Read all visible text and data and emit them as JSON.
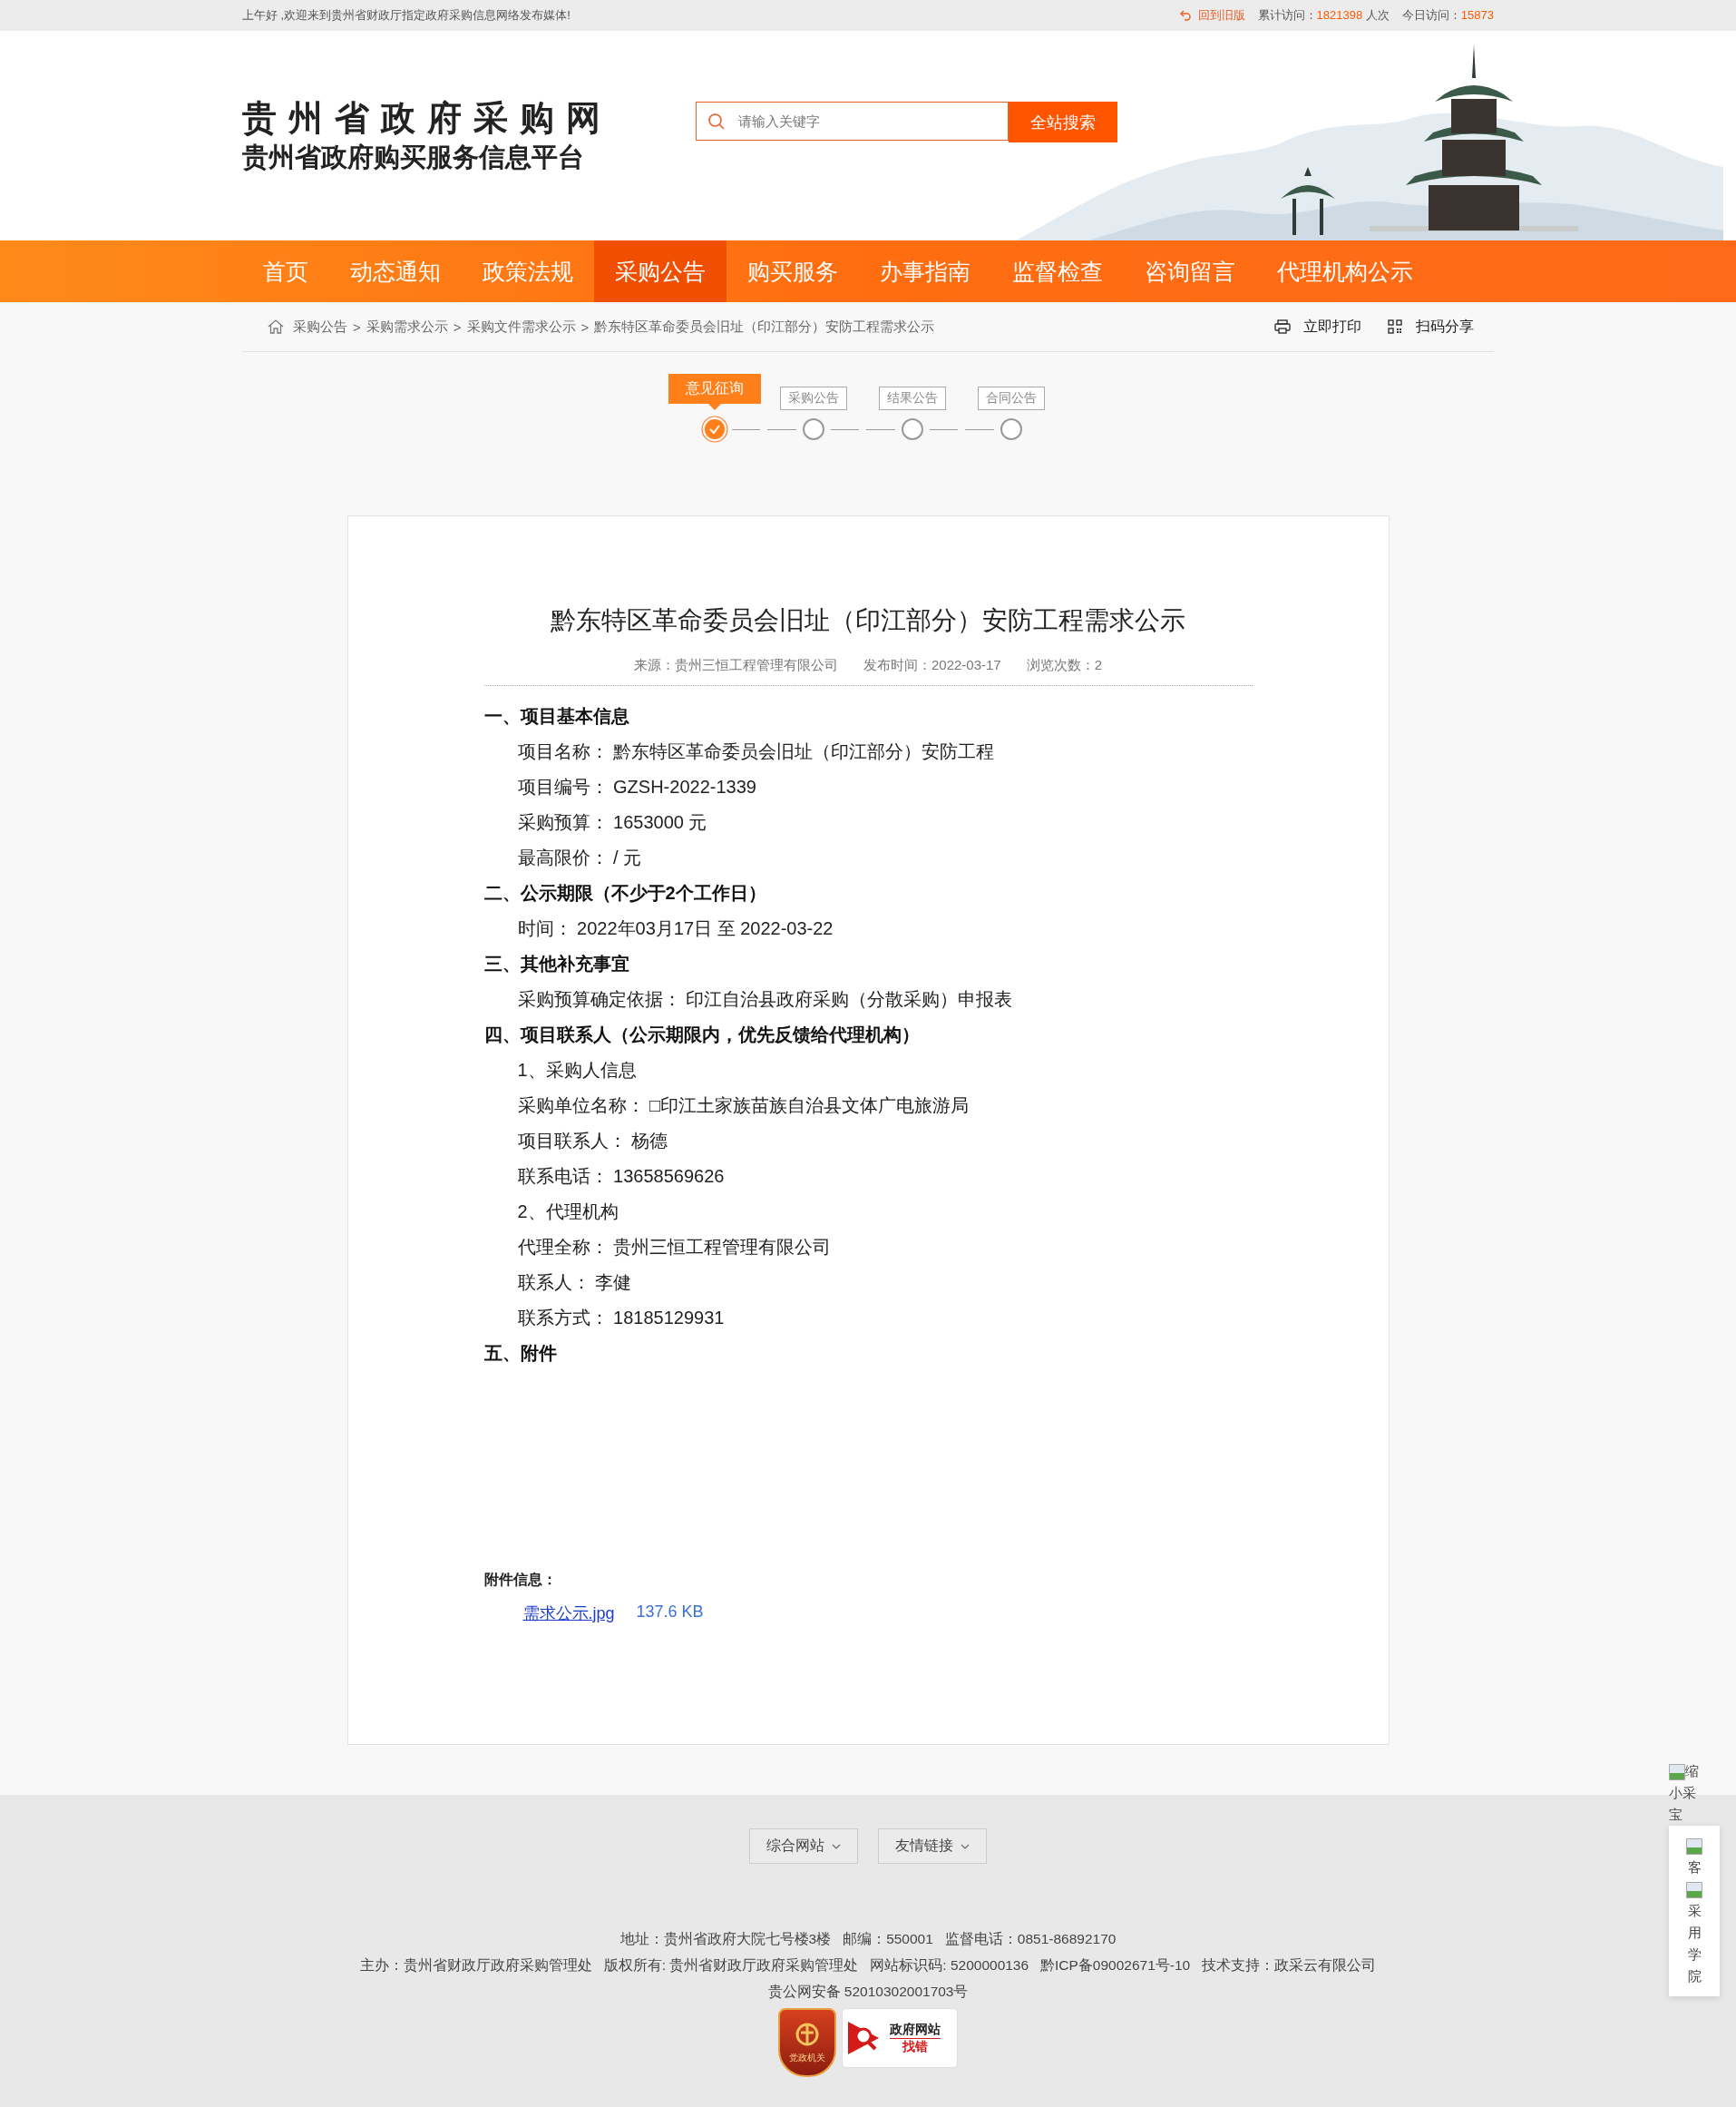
{
  "top_bar": {
    "greeting": "上午好 ,欢迎来到贵州省财政厅指定政府采购信息网络发布媒体!",
    "old_version_link": "回到旧版",
    "total_label": "累计访问：",
    "total_value": "1821398",
    "total_unit": "人次",
    "today_label": "今日访问：",
    "today_value": "15873"
  },
  "header": {
    "title": "贵州省政府采购网",
    "subtitle": "贵州省政府购买服务信息平台",
    "search": {
      "placeholder": "请输入关键字",
      "button": "全站搜索"
    }
  },
  "nav": [
    {
      "label": "首页",
      "selected": false
    },
    {
      "label": "动态通知",
      "selected": false
    },
    {
      "label": "政策法规",
      "selected": false
    },
    {
      "label": "采购公告",
      "selected": true
    },
    {
      "label": "购买服务",
      "selected": false
    },
    {
      "label": "办事指南",
      "selected": false
    },
    {
      "label": "监督检查",
      "selected": false
    },
    {
      "label": "咨询留言",
      "selected": false
    },
    {
      "label": "代理机构公示",
      "selected": false
    }
  ],
  "breadcrumb": {
    "separator": ">",
    "items": [
      "采购公告",
      "采购需求公示",
      "采购文件需求公示",
      "黔东特区革命委员会旧址（印江部分）安防工程需求公示"
    ]
  },
  "actions": [
    {
      "kind": "print",
      "label": "立即打印"
    },
    {
      "kind": "qr",
      "label": "扫码分享"
    }
  ],
  "steps": [
    {
      "label": "意见征询",
      "selected": true
    },
    {
      "label": "采购公告",
      "selected": false
    },
    {
      "label": "结果公告",
      "selected": false
    },
    {
      "label": "合同公告",
      "selected": false
    }
  ],
  "article": {
    "title": "黔东特区革命委员会旧址（印江部分）安防工程需求公示",
    "meta": [
      "来源：贵州三恒工程管理有限公司",
      "发布时间：2022-03-17",
      "浏览次数：2"
    ],
    "sections": [
      {
        "heading": "一、项目基本信息",
        "lines": [
          "项目名称： 黔东特区革命委员会旧址（印江部分）安防工程",
          "项目编号：  GZSH-2022-1339",
          "采购预算： 1653000 元",
          "最高限价： / 元"
        ]
      },
      {
        "heading": "二、公示期限（不少于2个工作日）",
        "lines": [
          "时间： 2022年03月17日 至  2022-03-22"
        ]
      },
      {
        "heading": "三、其他补充事宜",
        "lines": [
          "采购预算确定依据： 印江自治县政府采购（分散采购）申报表"
        ]
      },
      {
        "heading": "四、项目联系人（公示期限内，优先反馈给代理机构）",
        "lines": [
          "1、采购人信息",
          "采购单位名称： □印江土家族苗族自治县文体广电旅游局",
          "项目联系人： 杨德",
          "联系电话： 13658569626",
          "2、代理机构",
          "代理全称： 贵州三恒工程管理有限公司",
          "联系人： 李健",
          "联系方式： 18185129931"
        ]
      },
      {
        "heading": "五、附件"
      }
    ],
    "attachments": {
      "label": "附件信息：",
      "files": [
        {
          "name": "需求公示.jpg",
          "size": "137.6 KB"
        }
      ]
    }
  },
  "side_widgets": [
    "缩小采宝",
    "客",
    "采用学院"
  ],
  "footer": {
    "dropdowns": [
      "综合网站",
      "友情链接"
    ],
    "lines": [
      "地址：贵州省政府大院七号楼3楼   邮编：550001   监督电话：0851-86892170",
      "主办：贵州省财政厅政府采购管理处   版权所有: 贵州省财政厅政府采购管理处   网站标识码: 5200000136   黔ICP备09002671号-10   技术支持：政采云有限公司",
      "贵公网安备 52010302001703号"
    ],
    "badges": {
      "party": "党政机关",
      "error_title": "政府网站",
      "error_action": "找错"
    }
  }
}
